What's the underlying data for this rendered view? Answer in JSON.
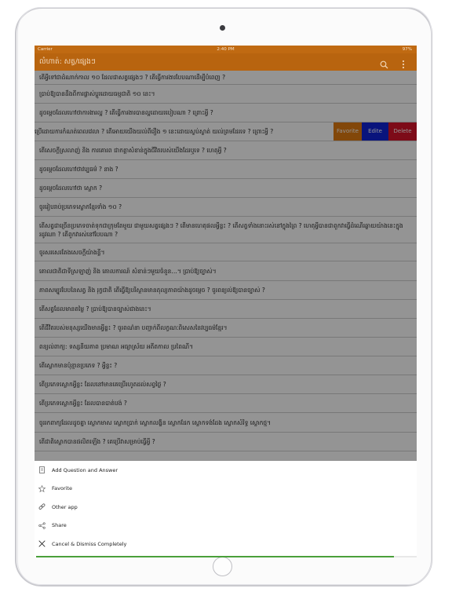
{
  "status_bar": {
    "carrier": "Carrier",
    "time": "2:40 PM",
    "battery": "97%"
  },
  "nav_bar": {
    "title": "លំហាត់: សត្វ/ផ្សេងៗ"
  },
  "rows": [
    {
      "text": "តើអ្វីទៅជាដំណាក់កាល ១០ ដែលជាសត្វផ្សេងៗ ? តើធ្វើការងារបែបណាដើម្បីបំពេញ ?",
      "height": 18
    },
    {
      "text": "ប្រាប់ឱ្យបានដឹងពីការផ្លាស់ប្ដូរដោយធម្មជាតិ ១០ នេះ។",
      "height": 24
    },
    {
      "text": "ដូចម្ដេចដែលហៅថាការងារល្អ ? តើធ្វើការងារបានល្អដោយរបៀបណា ? ព្រោះអ្វី ?",
      "height": 24
    },
    {
      "text": "ប្រើដោយការកំណត់ពេលវេលា ? តើអោយយើងយល់ពីរឿង ១ នេះដោយស្ងប់ស្ងាត់ យល់ព្រមដែរទេ ? ព្រោះអ្វី ?",
      "height": 24,
      "swiped": true
    },
    {
      "text": "តើសេចក្ដីស្រលាញ់ និង ការគោរព ជាកត្តាសំខាន់ក្នុងជីវិតរបស់យើងដែរឬទេ ? ហេតុអ្វី ?",
      "height": 24
    },
    {
      "text": "ដូចម្ដេចដែលហៅថាវប្បធម៌ ? នាង ?",
      "height": 24
    },
    {
      "text": "ដូចម្ដេចដែលហៅថា ស្លោក ?",
      "height": 24
    },
    {
      "text": "ចូររៀបរាប់ប្រភេទស្លោកខ្មែរទាំង ១០ ?",
      "height": 24
    },
    {
      "text": "តើសត្វជាច្រើនប្រភេទចាត់ទុកជាក្រុមតែមួយ ជាមួយសត្វផ្សេងៗ ? តើមានហេតុផលអ្វីខ្លះ ? តើសត្វទាំងនោះរស់នៅក្នុងព្រៃ ? ហេតុអ្វីបានជាពួកវាធ្វើដំណើរឆ្ងាយយ៉ាងនេះក្នុងរដូវណា ? តើពួកវារស់នៅបែបណា ?",
      "height": 34
    },
    {
      "text": "ចូរសរសេរតែងសេចក្ដីយ៉ាងខ្លី។",
      "height": 23
    },
    {
      "text": "គោលជាតិជាទីស្រឡាញ់ និង គោលការណ៍ សំខាន់ៗមួយចំនួន…។ ប្រាប់ឱ្យច្បាស់។",
      "height": 25
    },
    {
      "text": "ភាពសម្បូរបែបនៃសត្វ និង រុក្ខជាតិ តើធ្វើឱ្យបរិស្ថានមានតុល្យភាពយ៉ាងដូចម្ដេច ? ចូរពន្យល់ឱ្យបានច្បាស់ ?",
      "height": 24
    },
    {
      "text": "តើសត្វដែលមានតម្លៃ ? ប្រាប់ឱ្យបានច្បាស់ជាងនេះ។",
      "height": 24
    },
    {
      "text": "តើជីវិតរបស់មនុស្សយើងមានអ្វីខ្លះ ? ចូរពណ៌នា បញ្ជាក់ពីលក្ខណៈពិសេសនៃវប្បធម៌ខ្មែរ។",
      "height": 24
    },
    {
      "text": "ពន្យល់ពាក្យ: ទស្សនីយភាព ប្រមាណ អធ្យាស្រ័យ អតីតកាល ប្រពៃណី។",
      "height": 24
    },
    {
      "text": "តើស្លោកមានប៉ុន្មានប្រភេទ ? អ្វីខ្លះ ?",
      "height": 24
    },
    {
      "text": "តើប្រភេទស្លោកអ្វីខ្លះ ដែលនៅមានគេប្រើរហូតដល់សព្វថ្ងៃ ?",
      "height": 24
    },
    {
      "text": "តើប្រភេទស្លោកអ្វីខ្លះ ដែលបានបាត់បង់ ?",
      "height": 24
    },
    {
      "text": "ចូររកពាក្យដែលដូចគ្នា ស្លោកមាស ស្លោកប្រាក់ ស្លោកលង្ហិន ស្លោកដែក ស្លោកទង់ដែង ស្លោកសំរិទ្ធ ស្លោកថ្ម។",
      "height": 25
    },
    {
      "text": "តើជាតិស្លោកបានផលិតឡើង ? គេប្រើវាសម្រាប់ធ្វើអ្វី ?",
      "height": 24
    },
    {
      "text": "",
      "height": 24
    }
  ],
  "swipe_actions": {
    "favorite": "Favorite",
    "edit": "Edite",
    "delete": "Delete"
  },
  "sheet": {
    "items": [
      {
        "label": "Add Question and Answer",
        "icon": "document-icon"
      },
      {
        "label": "Favorite",
        "icon": "star-icon"
      },
      {
        "label": "Other app",
        "icon": "link-icon"
      },
      {
        "label": "Share",
        "icon": "share-icon"
      },
      {
        "label": "Cancel & Dismiss Completely",
        "icon": "close-icon"
      }
    ]
  },
  "progress": {
    "fraction": 0.94
  },
  "colors": {
    "nav_bar": "#b8640f",
    "favorite": "#e07a10",
    "edit": "#1024d6",
    "delete": "#d8142a",
    "progress": "#4aa03a"
  }
}
